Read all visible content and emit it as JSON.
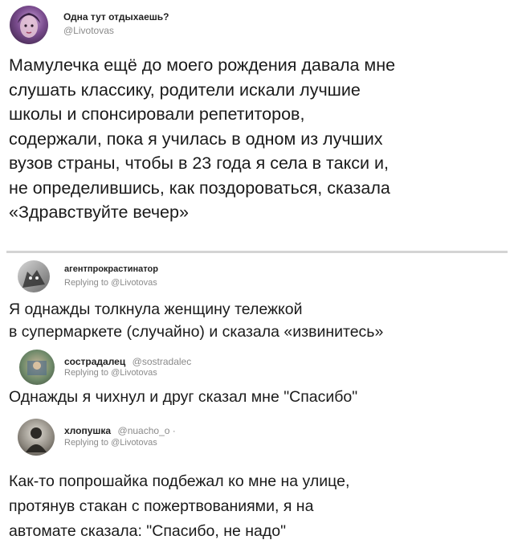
{
  "main_tweet": {
    "author_name": "Одна тут отдыхаешь?",
    "handle": "@Livotovas",
    "text_lines": [
      "Мамулечка ещё до моего рождения давала мне",
      "слушать классику, родители искали лучшие",
      "школы и спонсировали репетиторов,",
      "содержали, пока я училась в одном из лучших",
      "вузов страны, чтобы в 23 года я села в такси и,",
      "не определившись, как поздороваться, сказала",
      "«Здравствуйте вечер»"
    ]
  },
  "replies": [
    {
      "author_name": "агентпрокрастинатор",
      "handle": "",
      "replying_to": "Replying to @Livotovas",
      "text_lines": [
        "Я однажды толкнула женщину тележкой",
        "в супермаркете (случайно) и сказала «извинитесь»"
      ]
    },
    {
      "author_name": "сострадалец",
      "handle": "@sostradalec",
      "replying_to": "Replying to @Livotovas",
      "text_lines": [
        "Однажды я чихнул и друг сказал мне \"Спасибо\""
      ]
    },
    {
      "author_name": "хлопушка",
      "handle": "@nuacho_o ·",
      "replying_to": "Replying to @Livotovas",
      "text_lines": [
        "Как-то попрошайка подбежал ко мне на улице,",
        "протянув стакан с пожертвованиями, я на",
        "автомате сказала: \"Спасибо, не надо\""
      ]
    }
  ]
}
